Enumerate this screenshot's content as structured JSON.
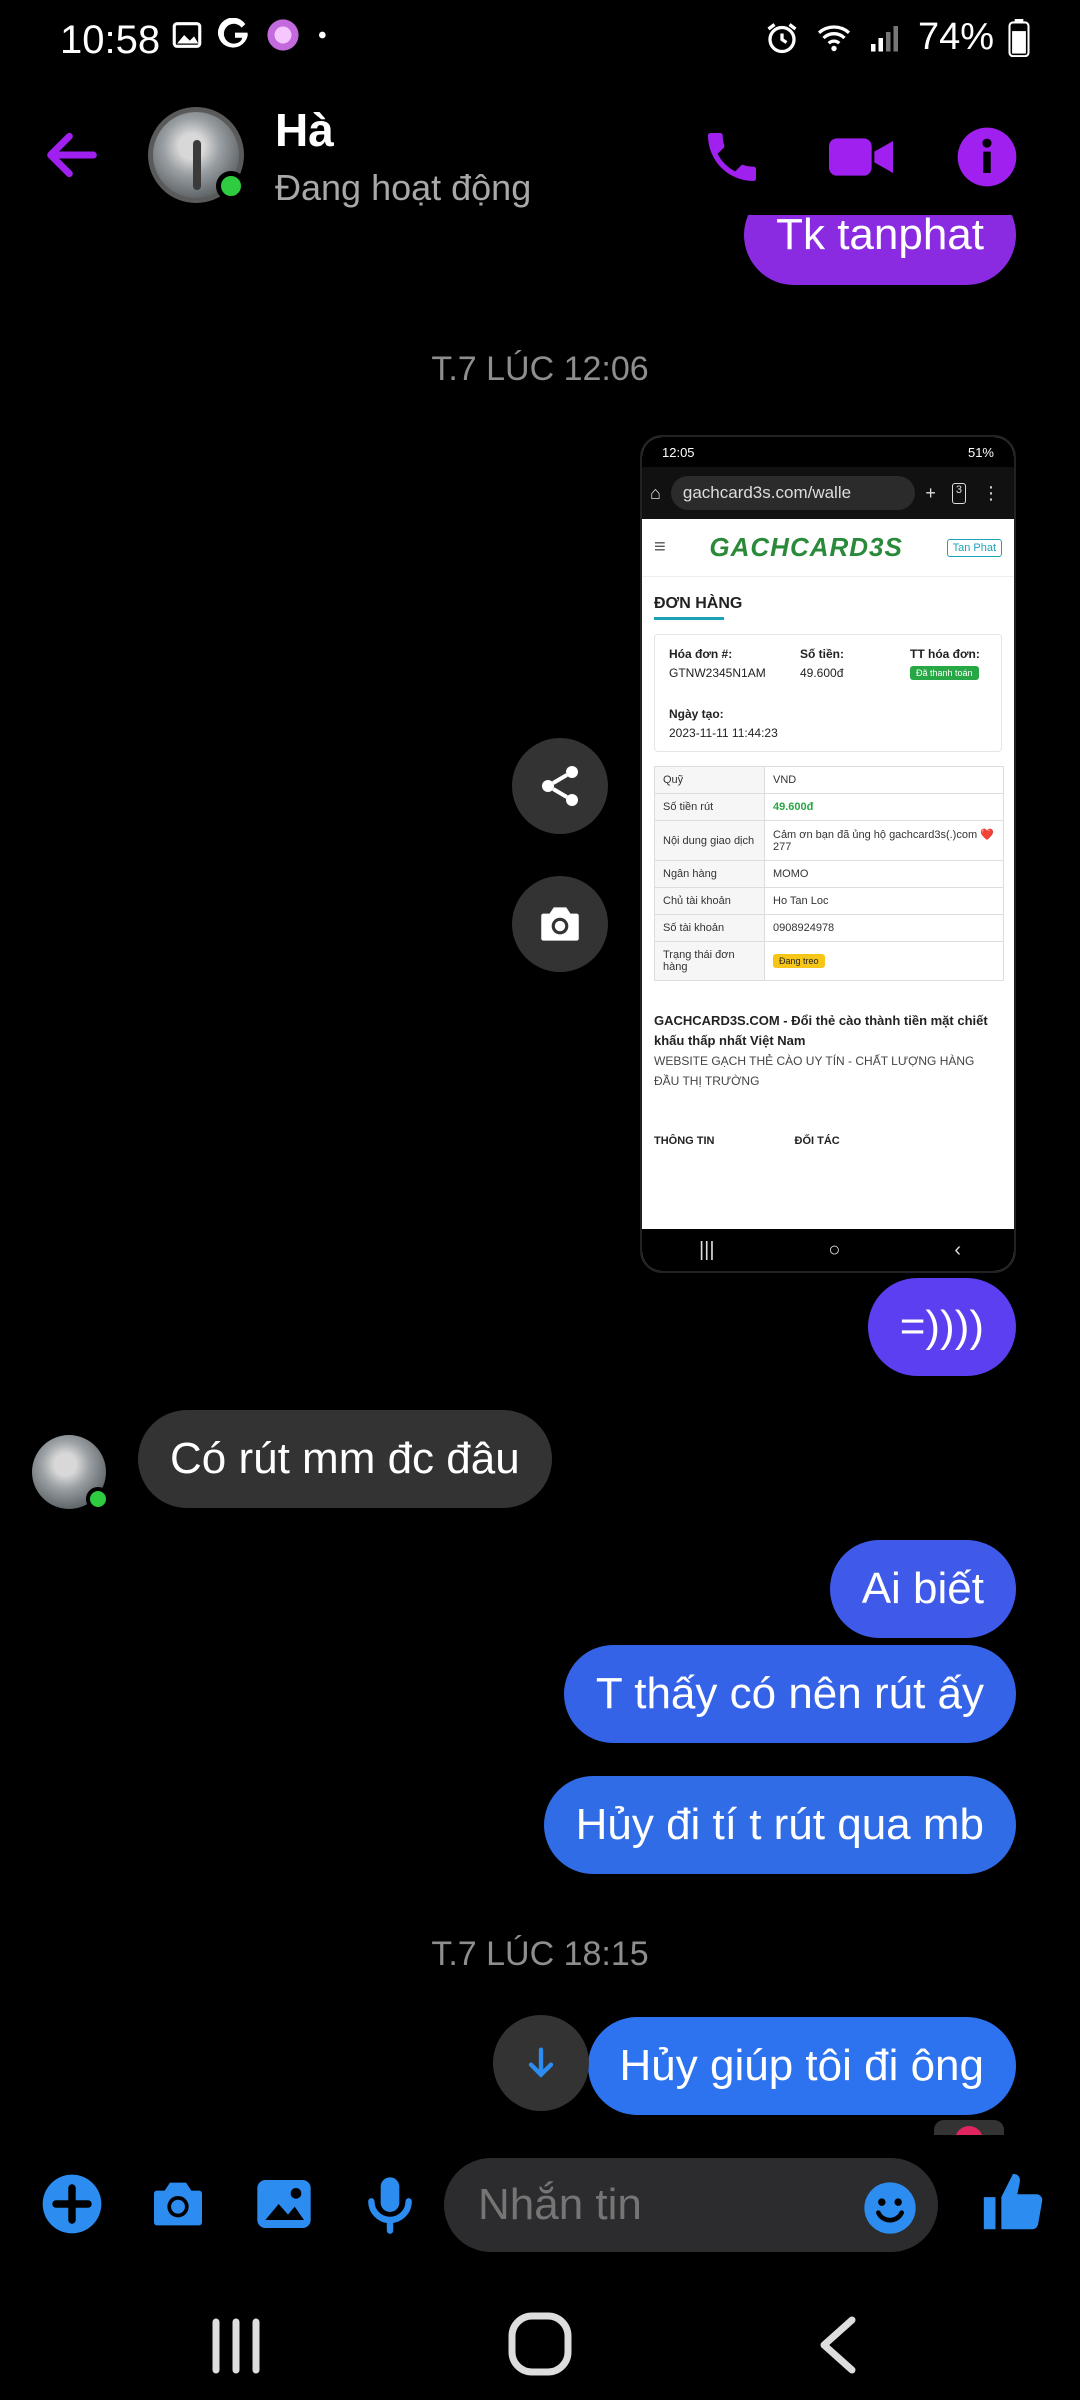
{
  "status_bar": {
    "time": "10:58",
    "battery": "74%",
    "icons_left": [
      "gallery-icon",
      "google-icon",
      "app-icon",
      "dot-icon"
    ],
    "icons_right": [
      "alarm-icon",
      "wifi-icon",
      "signal-icon",
      "battery-icon"
    ]
  },
  "header": {
    "name": "Hà",
    "status": "Đang hoạt động",
    "accent": "#a020f0"
  },
  "messages": {
    "sent_top": "Tk tanphat",
    "ts1": "T.7 LÚC 12:06",
    "sent_smile": "=))))",
    "received_1": "Có rút mm đc đâu",
    "sent_ai_biet": "Ai biết",
    "sent_t_thay": "T thấy có nên rút ấy",
    "sent_huy_di": "Hủy đi tí t rút qua mb",
    "ts2": "T.7 LÚC 18:15",
    "sent_huy_giup": "Hủy giúp tôi đi ông"
  },
  "screenshot": {
    "status_time": "12:05",
    "status_right": "51%",
    "url": "gachcard3s.com/walle",
    "tab_count": "3",
    "logo": "GACHCARD3S",
    "user_tag": "Tan Phat",
    "section_title": "ĐƠN HÀNG",
    "invoice_label": "Hóa đơn #:",
    "invoice_value": "GTNW2345N1AM",
    "amount_label": "Số tiền:",
    "amount_value": "49.600đ",
    "inv_status_label": "TT hóa đơn:",
    "inv_status_value": "Đã thanh toán",
    "date_label": "Ngày tạo:",
    "date_value": "2023-11-11 11:44:23",
    "rows": [
      {
        "k": "Quỹ",
        "v": "VND"
      },
      {
        "k": "Số tiền rút",
        "v": "49.600đ"
      },
      {
        "k": "Nội dung giao dịch",
        "v": "Cảm ơn bạn đã ủng hộ gachcard3s(.)com ❤️277"
      },
      {
        "k": "Ngân hàng",
        "v": "MOMO"
      },
      {
        "k": "Chủ tài khoản",
        "v": "Ho Tan Loc"
      },
      {
        "k": "Số tài khoản",
        "v": "0908924978"
      },
      {
        "k": "Trạng thái đơn hàng",
        "v": "Đang treo"
      }
    ],
    "footer_bold": "GACHCARD3S.COM - Đổi thẻ cào thành tiền mặt chiết khấu thấp nhất Việt Nam",
    "footer_normal": "WEBSITE GẠCH THẺ CÀO UY TÍN - CHẤT LƯỢNG HÀNG ĐẦU THỊ TRƯỜNG",
    "footer_cols": [
      "THÔNG TIN",
      "ĐỐI TÁC"
    ]
  },
  "composer": {
    "placeholder": "Nhắn tin"
  },
  "colors": {
    "sent_purple": "#5b3ff0",
    "sent_blue": "#2f6ce6",
    "received": "#333333",
    "icon_blue": "#2d8cf0"
  }
}
